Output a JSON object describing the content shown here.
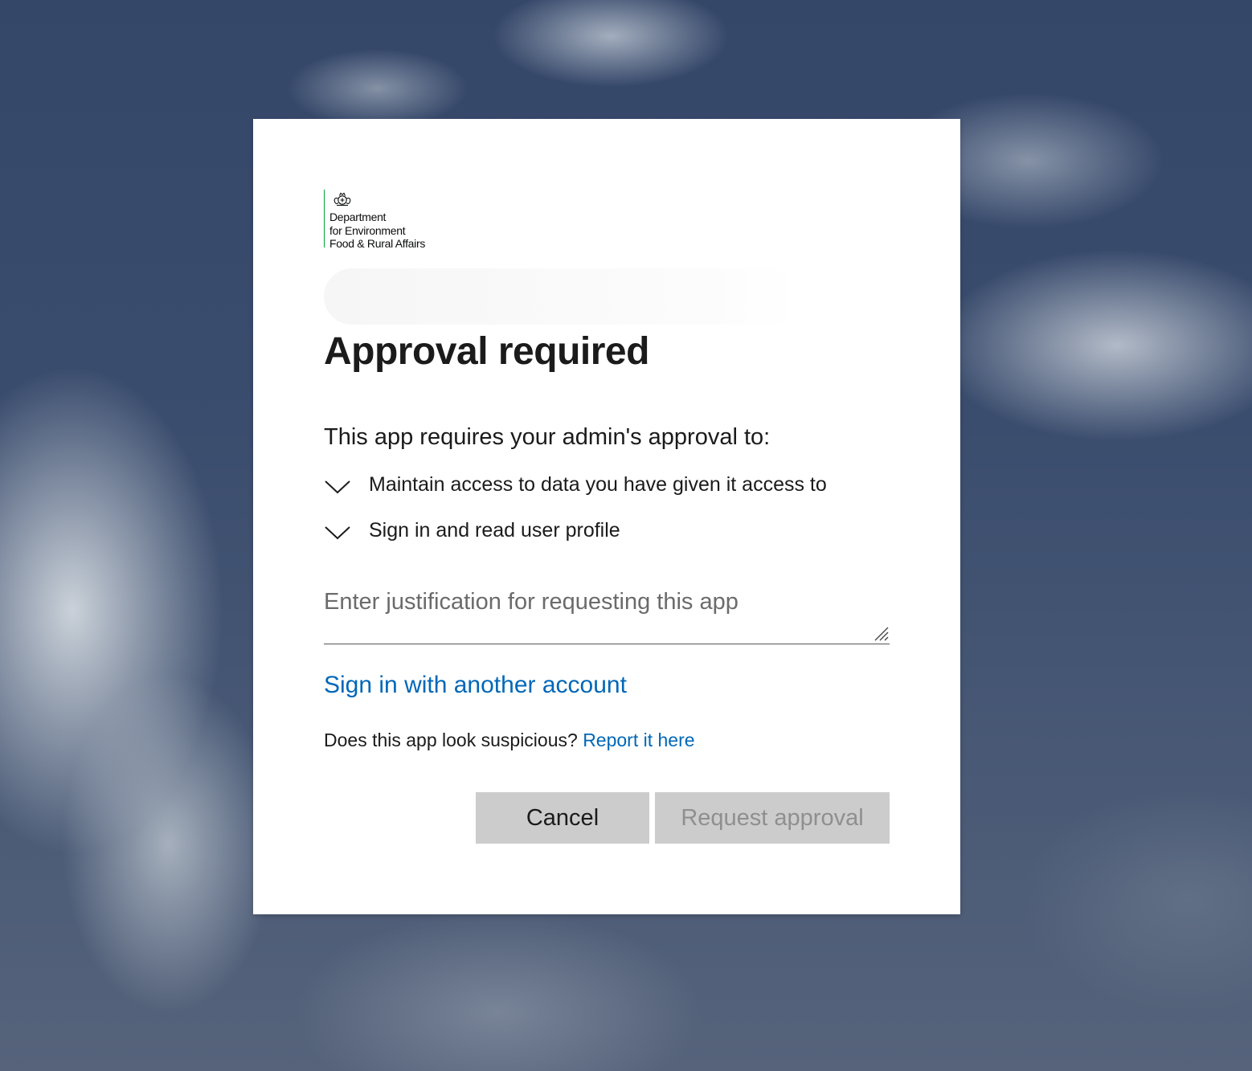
{
  "brand": {
    "org_line_1": "Department",
    "org_line_2": "for Environment",
    "org_line_3": "Food & Rural Affairs",
    "accent": "#00a33b",
    "crest_icon": "royal-crest-icon"
  },
  "dialog": {
    "title": "Approval required",
    "intro": "This app requires your admin's approval to:",
    "permissions": [
      {
        "label": "Maintain access to data you have given it access to",
        "icon": "chevron-down-icon"
      },
      {
        "label": "Sign in and read user profile",
        "icon": "chevron-down-icon"
      }
    ],
    "justification": {
      "placeholder": "Enter justification for requesting this app",
      "value": ""
    },
    "other_account_link": "Sign in with another account",
    "suspicious_text": "Does this app look suspicious?",
    "report_link": "Report it here",
    "buttons": {
      "cancel": "Cancel",
      "request": "Request approval"
    }
  },
  "colors": {
    "link": "#0067b8",
    "button_bg": "#cccccc",
    "disabled_text": "#8f8f8f"
  }
}
